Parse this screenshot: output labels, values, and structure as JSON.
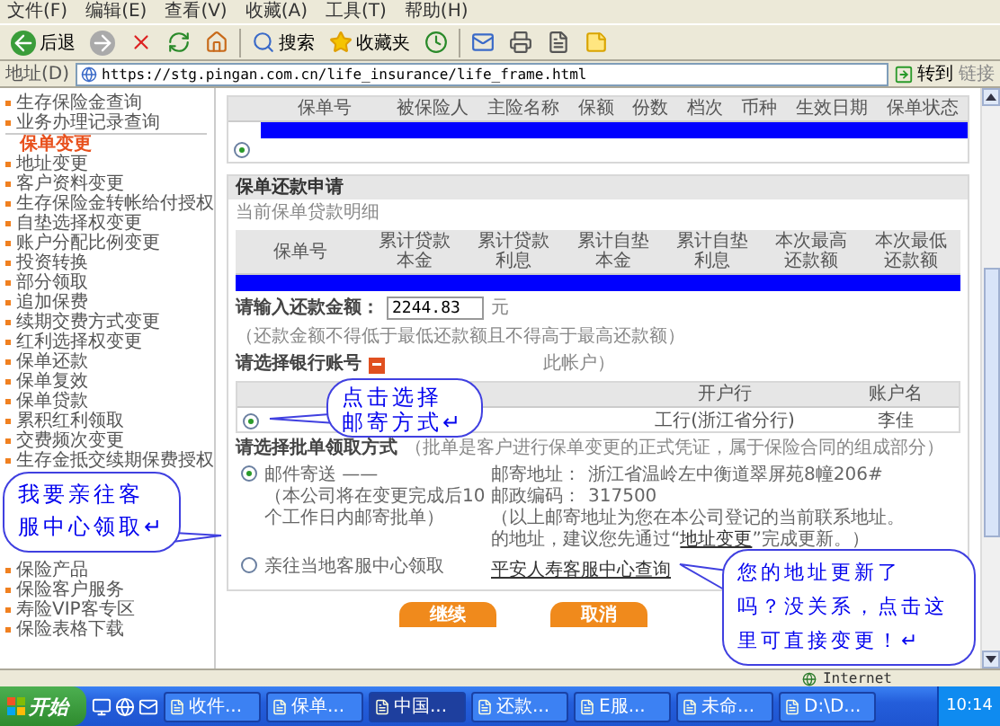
{
  "menu": [
    "文件(F)",
    "编辑(E)",
    "查看(V)",
    "收藏(A)",
    "工具(T)",
    "帮助(H)"
  ],
  "toolbar": {
    "back": "后退",
    "search": "搜索",
    "favorites": "收藏夹"
  },
  "address": {
    "label": "地址(D)",
    "url": "https://stg.pingan.com.cn/life_insurance/life_frame.html",
    "go": "转到",
    "links": "链接"
  },
  "sidebar": {
    "items": [
      {
        "label": "生存保险金查询",
        "kind": "item"
      },
      {
        "label": "业务办理记录查询",
        "kind": "item"
      },
      {
        "label": "保单变更",
        "kind": "header"
      },
      {
        "label": "地址变更",
        "kind": "item"
      },
      {
        "label": "客户资料变更",
        "kind": "item"
      },
      {
        "label": "生存保险金转帐给付授权",
        "kind": "item"
      },
      {
        "label": "自垫选择权变更",
        "kind": "item"
      },
      {
        "label": "账户分配比例变更",
        "kind": "item"
      },
      {
        "label": "投资转换",
        "kind": "item"
      },
      {
        "label": "部分领取",
        "kind": "item"
      },
      {
        "label": "追加保费",
        "kind": "item"
      },
      {
        "label": "续期交费方式变更",
        "kind": "item"
      },
      {
        "label": "红利选择权变更",
        "kind": "item"
      },
      {
        "label": "保单还款",
        "kind": "item"
      },
      {
        "label": "保单复效",
        "kind": "item"
      },
      {
        "label": "保单贷款",
        "kind": "item"
      },
      {
        "label": "累积红利领取",
        "kind": "item"
      },
      {
        "label": "交费频次变更",
        "kind": "item"
      },
      {
        "label": "生存金抵交续期保费授权",
        "kind": "item"
      }
    ],
    "lower_items": [
      {
        "label": "保险产品",
        "kind": "item"
      },
      {
        "label": "保险客户服务",
        "kind": "item"
      },
      {
        "label": "寿险VIP客专区",
        "kind": "item"
      },
      {
        "label": "保险表格下载",
        "kind": "item"
      }
    ]
  },
  "policy_table": {
    "columns": [
      "保单号",
      "被保险人",
      "主险名称",
      "保额",
      "份数",
      "档次",
      "币种",
      "生效日期",
      "保单状态"
    ],
    "rows": [
      {
        "selected": true
      }
    ]
  },
  "repay": {
    "title": "保单还款申请",
    "subtitle": "当前保单贷款明细",
    "columns": [
      "保单号",
      "累计贷款本金",
      "累计贷款利息",
      "累计自垫本金",
      "累计自垫利息",
      "本次最高还款额",
      "本次最低还款额"
    ],
    "amount_label": "请输入还款金额：",
    "amount": "2244.83",
    "unit": "元",
    "amount_note": "（还款金额不得低于最低还款额且不得高于最高还款额）"
  },
  "bank": {
    "label": "请选择银行账号",
    "note": "此帐户）",
    "columns": [
      "开户行",
      "账户名"
    ],
    "rows": [
      {
        "selected": true,
        "bank": "工行(浙江省分行)",
        "holder": "李佳"
      }
    ]
  },
  "delivery": {
    "label": "请选择批单领取方式",
    "note": "（批单是客户进行保单变更的正式凭证，属于保险合同的组成部分）",
    "options": [
      {
        "kind": "mail",
        "selected": true,
        "label": "邮件寄送 ——",
        "detail": "（本公司将在变更完成后10个工作日内邮寄批单）",
        "address_label": "邮寄地址：",
        "address": "浙江省温岭左中衡道翠屏苑8幢206#",
        "postcode_label": "邮政编码：",
        "postcode": "317500",
        "notice_1": "（以上邮寄地址为您在本公司登记的当前联系地址。",
        "notice_2": "的地址，建议您先通过“",
        "notice_link": "地址变更",
        "notice_3": "”完成更新。）"
      },
      {
        "kind": "pickup",
        "selected": false,
        "label": "亲往当地客服中心领取",
        "link": "平安人寿客服中心查询"
      }
    ]
  },
  "buttons": [
    "继续",
    "取消"
  ],
  "callouts": [
    {
      "lines": [
        "点击选择",
        "邮寄方式↵"
      ]
    },
    {
      "lines": [
        "我要亲往客",
        "服中心领取↵"
      ]
    },
    {
      "lines": [
        "您的地址更新了",
        "吗？没关系，点击这",
        "里可直接变更！↵"
      ]
    }
  ],
  "status": {
    "zone": "Internet"
  },
  "taskbar": {
    "start": "开始",
    "tasks": [
      {
        "label": "收件...",
        "selected": false
      },
      {
        "label": "保单...",
        "selected": false
      },
      {
        "label": "中国...",
        "selected": true
      },
      {
        "label": "还款...",
        "selected": false
      },
      {
        "label": "E服...",
        "selected": false
      },
      {
        "label": "未命...",
        "selected": false
      },
      {
        "label": "D:\\D...",
        "selected": false
      }
    ],
    "clock": "10:14"
  }
}
